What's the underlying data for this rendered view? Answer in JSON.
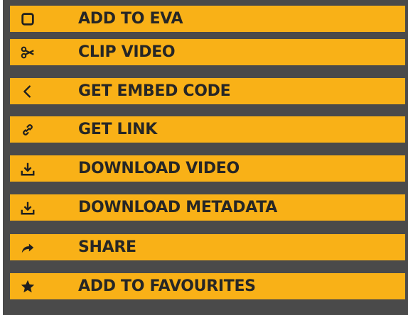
{
  "menu": {
    "items": [
      {
        "label": "ADD TO EVA",
        "icon": "square-outline-icon"
      },
      {
        "label": "CLIP VIDEO",
        "icon": "scissors-icon"
      },
      {
        "label": "GET EMBED CODE",
        "icon": "chevron-left-icon"
      },
      {
        "label": "GET LINK",
        "icon": "link-icon"
      },
      {
        "label": "DOWNLOAD VIDEO",
        "icon": "download-icon"
      },
      {
        "label": "DOWNLOAD METADATA",
        "icon": "download-icon"
      },
      {
        "label": "SHARE",
        "icon": "share-arrow-icon"
      },
      {
        "label": "ADD TO FAVOURITES",
        "icon": "star-icon"
      }
    ],
    "colors": {
      "panel_bg": "#4a4a4a",
      "item_bg": "#f9b117",
      "text": "#262626"
    }
  }
}
